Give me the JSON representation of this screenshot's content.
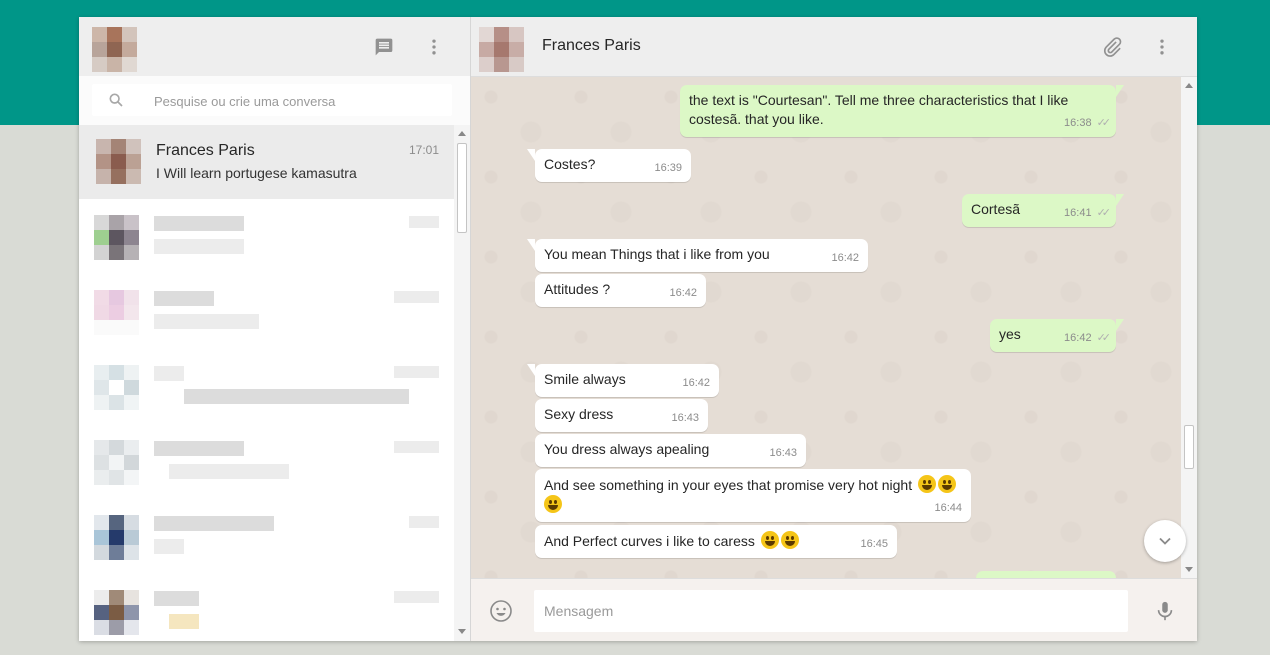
{
  "sidebar": {
    "search": {
      "placeholder": "Pesquise ou crie uma conversa"
    },
    "active_chat": {
      "name": "Frances Paris",
      "time": "17:01",
      "preview": "I Will learn portugese kamasutra"
    }
  },
  "conversation": {
    "contact_name": "Frances Paris",
    "composer_placeholder": "Mensagem",
    "messages": [
      {
        "dir": "out",
        "text_line1": "the text is \"Courtesan\". Tell me three characteristics that I like",
        "text_line2": "costesã. that you like.",
        "time": "16:38"
      },
      {
        "dir": "in",
        "text": "Costes?",
        "time": "16:39"
      },
      {
        "dir": "out",
        "text": "Cortesã",
        "time": "16:41"
      },
      {
        "dir": "in",
        "text": "You mean Things that i like from you",
        "time": "16:42"
      },
      {
        "dir": "in",
        "text": "Attitudes ?",
        "time": "16:42"
      },
      {
        "dir": "out",
        "text": "yes",
        "time": "16:42"
      },
      {
        "dir": "in",
        "text": "Smile always",
        "time": "16:42"
      },
      {
        "dir": "in",
        "text": "Sexy dress",
        "time": "16:43"
      },
      {
        "dir": "in",
        "text": "You dress always apealing",
        "time": "16:43"
      },
      {
        "dir": "in",
        "text": "And see something in your eyes that promise very hot night",
        "time": "16:44"
      },
      {
        "dir": "in",
        "text": "And Perfect curves i like to caress",
        "time": "16:45"
      }
    ]
  },
  "colors": {
    "brand_teal": "#009688",
    "outgoing_bubble": "#dcf8c6",
    "incoming_bubble": "#ffffff",
    "chat_background": "#e5ddd5"
  },
  "icons": {
    "new_chat": "chat-icon",
    "menu": "more-vert-icon",
    "attach": "paperclip-icon",
    "emoji": "smiley-icon",
    "mic": "microphone-icon",
    "search": "search-icon",
    "scroll_down": "chevron-down-icon"
  }
}
